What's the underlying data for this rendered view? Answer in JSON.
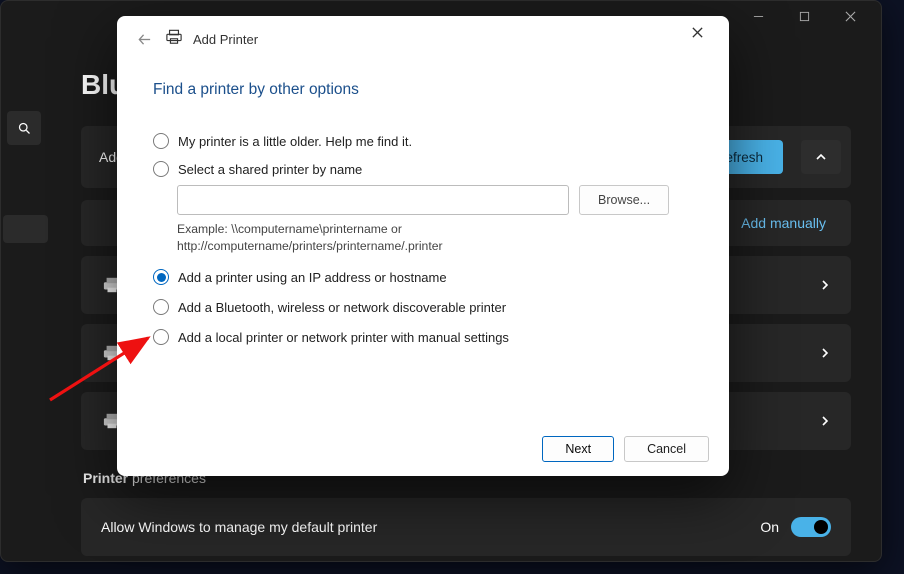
{
  "settings": {
    "titleFragment": "Blu",
    "addRowLabel": "Add",
    "refresh": "Refresh",
    "addManually": "Add manually",
    "prefHeaderHtml": "Printer",
    "prefHeaderRest": " preferences",
    "prefRow": "Allow Windows to manage my default printer",
    "prefState": "On"
  },
  "dialog": {
    "title": "Add Printer",
    "heading": "Find a printer by other options",
    "opt_older": "My printer is a little older. Help me find it.",
    "opt_shared": "Select a shared printer by name",
    "browse": "Browse...",
    "example": "Example: \\\\computername\\printername or http://computername/printers/printername/.printer",
    "opt_ip": "Add a printer using an IP address or hostname",
    "opt_bt": "Add a Bluetooth, wireless or network discoverable printer",
    "opt_local": "Add a local printer or network printer with manual settings",
    "next": "Next",
    "cancel": "Cancel"
  }
}
